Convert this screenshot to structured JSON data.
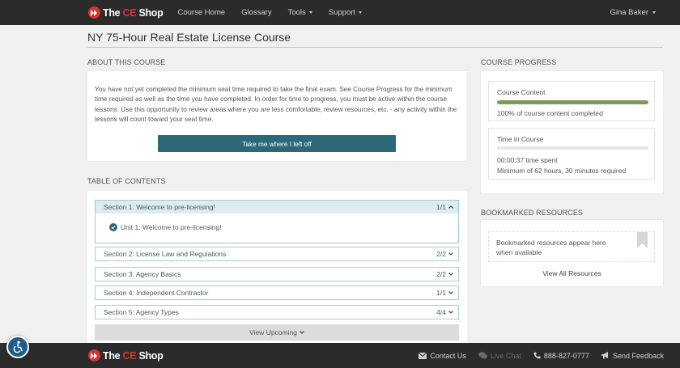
{
  "brand": {
    "name_prefix": "The ",
    "name_accent": "CE",
    "name_suffix": " Shop",
    "accent_color": "#d9342b"
  },
  "nav": {
    "links": [
      {
        "label": "Course Home"
      },
      {
        "label": "Glossary"
      },
      {
        "label": "Tools"
      },
      {
        "label": "Support"
      }
    ],
    "user": "Gina Baker"
  },
  "page": {
    "title": "NY 75-Hour Real Estate License Course"
  },
  "about": {
    "heading": "ABOUT THIS COURSE",
    "text": "You have not yet completed the minimum seat time required to take the final exam. See Course Progress for the minimum time required as well as the time you have completed. In order for time to progress, you must be active within the course lessons. Use this opportunity to review areas where you are less comfortable, review resources, etc. - any activity within the lessons will count toward your seat time.",
    "button": "Take me where I left off"
  },
  "toc": {
    "heading": "TABLE OF CONTENTS",
    "sections": [
      {
        "label": "Section 1: Welcome to pre-licensing!",
        "count": "1/1",
        "expanded": true
      },
      {
        "label": "Section 2: License Law and Regulations",
        "count": "2/2",
        "expanded": false
      },
      {
        "label": "Section 3: Agency Basics",
        "count": "2/2",
        "expanded": false
      },
      {
        "label": "Section 4: Independent Contractor",
        "count": "1/1",
        "expanded": false
      },
      {
        "label": "Section 5: Agency Types",
        "count": "4/4",
        "expanded": false
      }
    ],
    "unit": "Unit 1: Welcome to pre-licensing!",
    "view_upcoming": "View Upcoming"
  },
  "progress": {
    "heading": "COURSE PROGRESS",
    "content": {
      "title": "Course Content",
      "percent": 100,
      "summary": "100% of course content completed",
      "bar_color": "#7e9a55"
    },
    "time": {
      "title": "Time in Course",
      "percent": 0,
      "spent": "00:00:37 time spent",
      "minimum": "Minimum of 62 hours, 30 minutes required"
    }
  },
  "bookmarks": {
    "heading": "BOOKMARKED RESOURCES",
    "empty_text": "Bookmarked resources appear here when available",
    "view_all": "View All Resources"
  },
  "footer": {
    "links": [
      {
        "label": "Contact Us",
        "icon": "envelope-icon"
      },
      {
        "label": "Live Chat",
        "icon": "chat-icon",
        "disabled": true
      },
      {
        "label": "888-827-0777",
        "icon": "phone-icon"
      },
      {
        "label": "Send Feedback",
        "icon": "megaphone-icon"
      }
    ]
  }
}
